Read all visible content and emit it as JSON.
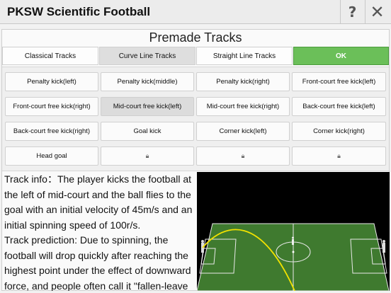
{
  "app": {
    "title": "PKSW Scientific Football",
    "help_icon": "?",
    "close_icon": "✕"
  },
  "panel": {
    "title": "Premade Tracks"
  },
  "tabs": [
    {
      "label": "Classical Tracks"
    },
    {
      "label": "Curve Line Tracks"
    },
    {
      "label": "Straight Line Tracks"
    },
    {
      "label": "OK"
    }
  ],
  "tracks": [
    {
      "label": "Penalty kick(left)"
    },
    {
      "label": "Penalty kick(middle)"
    },
    {
      "label": "Penalty kick(right)"
    },
    {
      "label": "Front-court free kick(left)"
    },
    {
      "label": "Front-court free kick(right)"
    },
    {
      "label": "Mid-court free kick(left)"
    },
    {
      "label": "Mid-court free kick(right)"
    },
    {
      "label": "Back-court free kick(left)"
    },
    {
      "label": "Back-court free kick(right)"
    },
    {
      "label": "Goal kick"
    },
    {
      "label": "Corner kick(left)"
    },
    {
      "label": "Corner kick(right)"
    },
    {
      "label": "Head goal"
    },
    {
      "label": "",
      "locked": true
    },
    {
      "label": "",
      "locked": true
    },
    {
      "label": "",
      "locked": true
    }
  ],
  "info": {
    "paragraph1": "Track info：The player kicks the football at the left of mid-court and the ball flies to the goal with an initial velocity of 45m/s and an initial spinning speed of 100r/s.",
    "paragraph2": "Track prediction: Due to spinning, the football will drop quickly after reaching the highest point under the effect of downward force, and people often call it \"fallen-leave"
  },
  "colors": {
    "ok_green": "#6bbf59",
    "pitch_green": "#3f7a2f",
    "trajectory_yellow": "#f2e200",
    "selected_gray": "#dcdcdc"
  },
  "icons": {
    "lock": "lock-icon",
    "help": "question-icon",
    "close": "close-icon"
  }
}
